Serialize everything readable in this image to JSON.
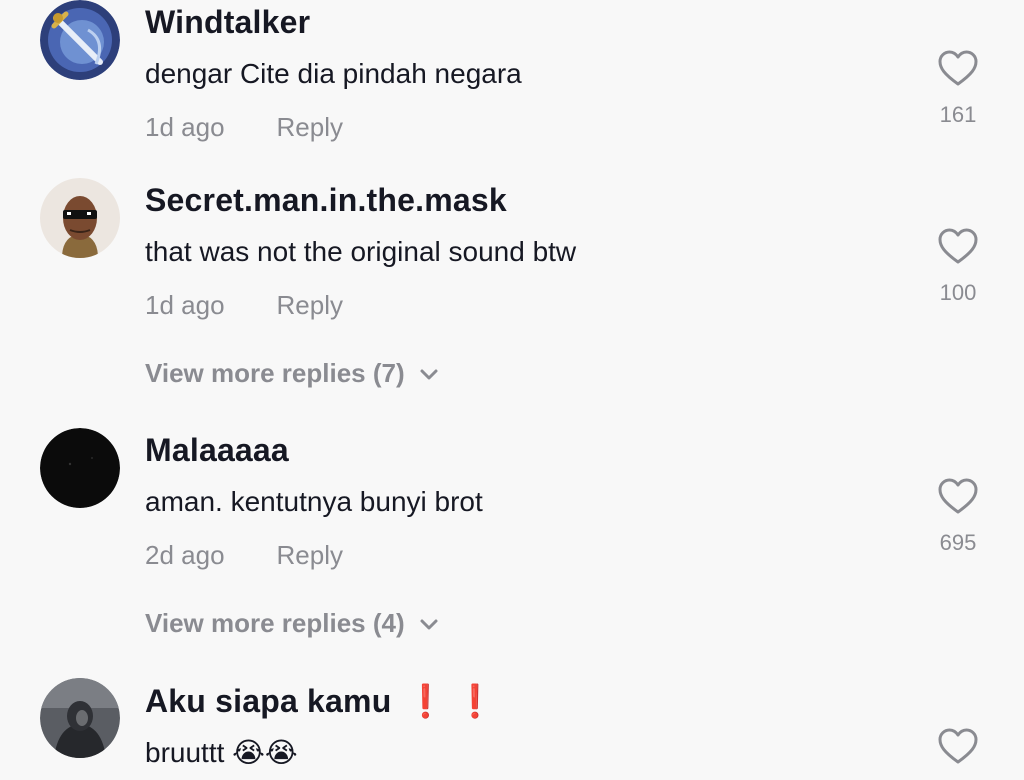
{
  "comments": [
    {
      "username": "Windtalker",
      "text": "dengar Cite dia pindah negara",
      "time": "1d ago",
      "reply_label": "Reply",
      "likes": "161",
      "avatar_icon": "sword-avatar"
    },
    {
      "username": "Secret.man.in.the.mask",
      "text": "that was not the original sound btw",
      "time": "1d ago",
      "reply_label": "Reply",
      "likes": "100",
      "avatar_icon": "masked-face-avatar",
      "view_more": "View more replies (7)"
    },
    {
      "username": "Malaaaaa",
      "text": "aman. kentutnya bunyi brot",
      "time": "2d ago",
      "reply_label": "Reply",
      "likes": "695",
      "avatar_icon": "dark-avatar",
      "view_more": "View more replies (4)"
    },
    {
      "username": "Aku siapa kamu",
      "username_suffix": "❗❗",
      "text": "bruuttt 😭😭",
      "avatar_icon": "hooded-person-avatar"
    }
  ],
  "colors": {
    "background": "#f8f8f8",
    "primary_text": "#161823",
    "secondary_text": "#8a8b91",
    "exclamation": "#e52622"
  }
}
